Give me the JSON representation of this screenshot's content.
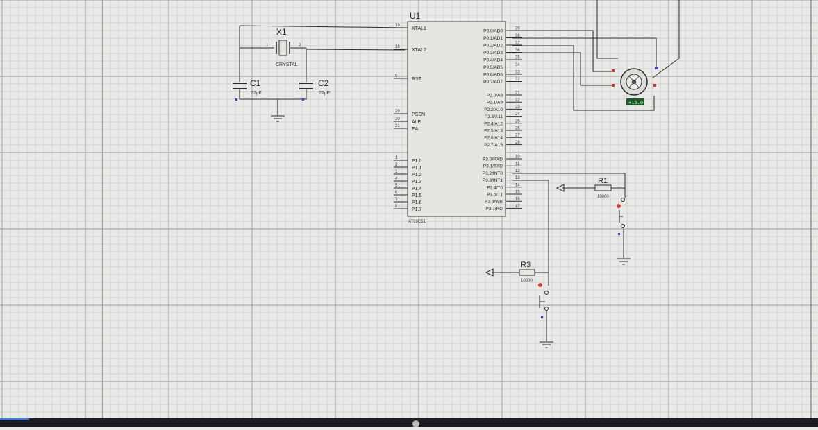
{
  "mcu": {
    "ref": "U1",
    "part": "AT89C51",
    "left_pins": [
      {
        "num": "19",
        "name": "XTAL1"
      },
      {
        "num": "18",
        "name": "XTAL2"
      },
      {
        "num": "9",
        "name": "RST"
      },
      {
        "num": "29",
        "name": "PSEN"
      },
      {
        "num": "30",
        "name": "ALE"
      },
      {
        "num": "31",
        "name": "EA"
      },
      {
        "num": "1",
        "name": "P1.0"
      },
      {
        "num": "2",
        "name": "P1.1"
      },
      {
        "num": "3",
        "name": "P1.2"
      },
      {
        "num": "4",
        "name": "P1.3"
      },
      {
        "num": "5",
        "name": "P1.4"
      },
      {
        "num": "6",
        "name": "P1.5"
      },
      {
        "num": "7",
        "name": "P1.6"
      },
      {
        "num": "8",
        "name": "P1.7"
      }
    ],
    "right_pins": [
      {
        "num": "39",
        "name": "P0.0/AD0"
      },
      {
        "num": "38",
        "name": "P0.1/AD1"
      },
      {
        "num": "37",
        "name": "P0.2/AD2"
      },
      {
        "num": "36",
        "name": "P0.3/AD3"
      },
      {
        "num": "35",
        "name": "P0.4/AD4"
      },
      {
        "num": "34",
        "name": "P0.5/AD5"
      },
      {
        "num": "33",
        "name": "P0.6/AD6"
      },
      {
        "num": "32",
        "name": "P0.7/AD7"
      },
      {
        "num": "21",
        "name": "P2.0/A8"
      },
      {
        "num": "22",
        "name": "P2.1/A9"
      },
      {
        "num": "23",
        "name": "P2.2/A10"
      },
      {
        "num": "24",
        "name": "P2.3/A11"
      },
      {
        "num": "25",
        "name": "P2.4/A12"
      },
      {
        "num": "26",
        "name": "P2.5/A13"
      },
      {
        "num": "27",
        "name": "P2.6/A14"
      },
      {
        "num": "28",
        "name": "P2.7/A15"
      },
      {
        "num": "10",
        "name": "P3.0/RXD"
      },
      {
        "num": "11",
        "name": "P3.1/TXD"
      },
      {
        "num": "12",
        "name": "P3.2/INT0"
      },
      {
        "num": "13",
        "name": "P3.3/INT1"
      },
      {
        "num": "14",
        "name": "P3.4/T0"
      },
      {
        "num": "15",
        "name": "P3.5/T1"
      },
      {
        "num": "16",
        "name": "P3.6/WR"
      },
      {
        "num": "17",
        "name": "P3.7/RD"
      }
    ]
  },
  "crystal": {
    "ref": "X1",
    "value": "CRYSTAL",
    "pin1": "1",
    "pin2": "2"
  },
  "capacitors": [
    {
      "ref": "C1",
      "value": "22pF"
    },
    {
      "ref": "C2",
      "value": "22pF"
    }
  ],
  "resistors": [
    {
      "ref": "R1",
      "value": "10000"
    },
    {
      "ref": "R3",
      "value": "10000"
    }
  ],
  "motor": {
    "readout": "+15.0"
  },
  "colors": {
    "grid_minor": "#c8c8c6",
    "grid_major": "#a9a9a6",
    "wire": "#2c2c2c",
    "chip_fill": "#e4e4e0",
    "pin_dot": "#3a3ad0",
    "terminal_red": "#d23a2a",
    "readout_bg": "#1e5a2a",
    "readout_fg": "#a6f0a6"
  }
}
